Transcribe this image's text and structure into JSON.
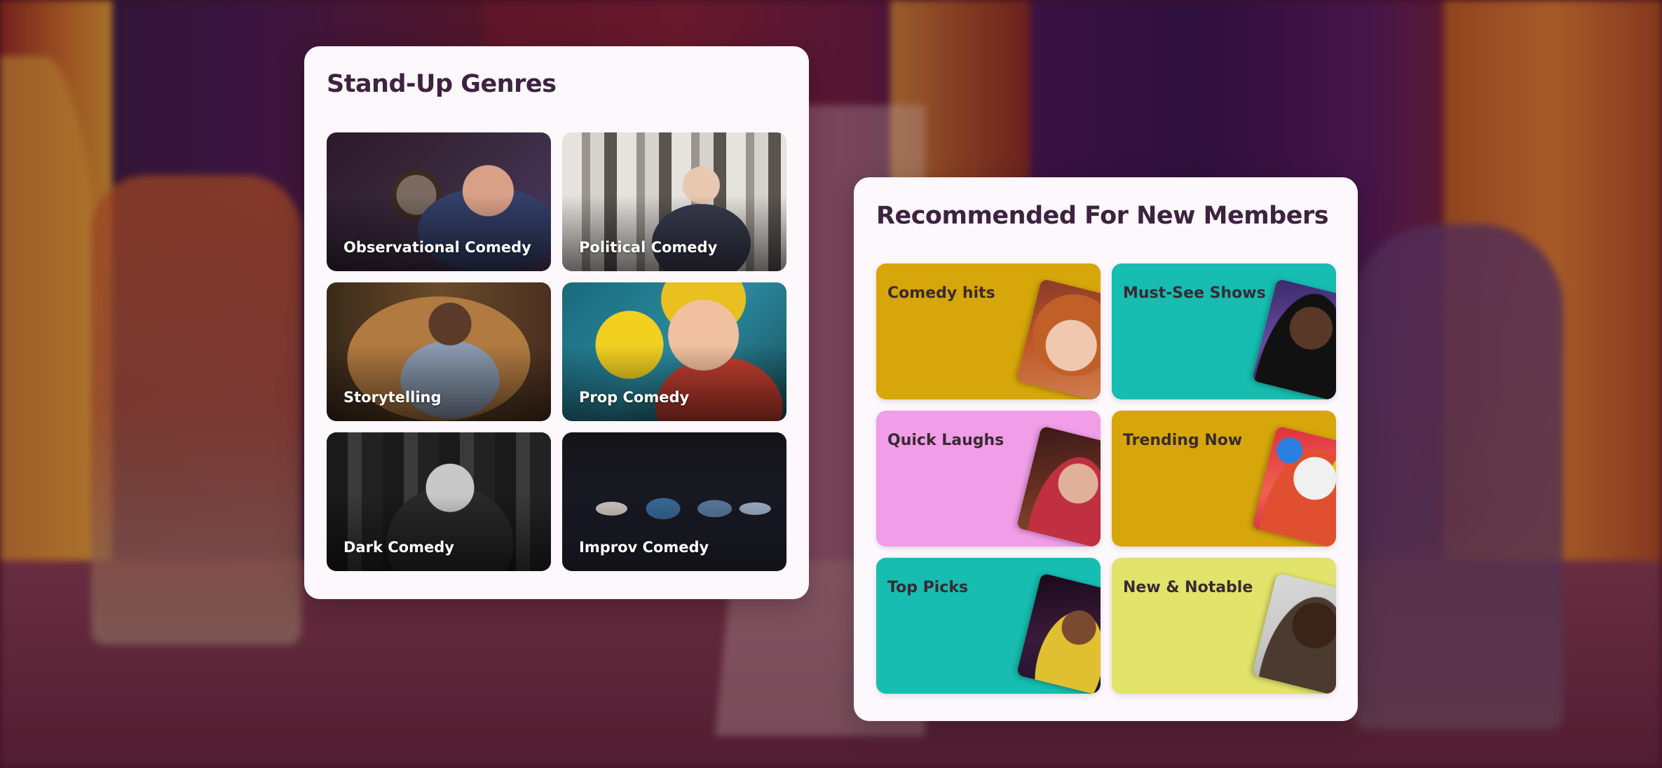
{
  "colors": {
    "panel_bg": "#fdf8fc",
    "title_text": "#3d2340",
    "mustard": "#d6a60a",
    "teal": "#16bdb0",
    "pink": "#f19de8",
    "lime": "#e2e36a"
  },
  "genres": {
    "title": "Stand-Up Genres",
    "items": [
      {
        "label": "Observational Comedy"
      },
      {
        "label": "Political Comedy"
      },
      {
        "label": "Storytelling"
      },
      {
        "label": "Prop Comedy"
      },
      {
        "label": "Dark Comedy"
      },
      {
        "label": "Improv Comedy"
      }
    ]
  },
  "recommended": {
    "title": "Recommended For New Members",
    "items": [
      {
        "label": "Comedy hits",
        "color": "#d6a60a"
      },
      {
        "label": "Must-See Shows",
        "color": "#16bdb0"
      },
      {
        "label": "Quick Laughs",
        "color": "#f19de8"
      },
      {
        "label": "Trending Now",
        "color": "#d6a60a"
      },
      {
        "label": "Top Picks",
        "color": "#16bdb0"
      },
      {
        "label": "New & Notable",
        "color": "#e2e36a"
      }
    ]
  }
}
